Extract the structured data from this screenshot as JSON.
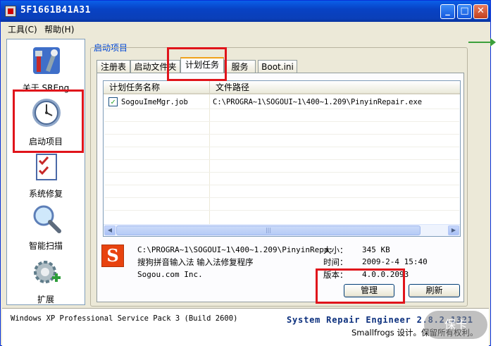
{
  "window": {
    "title": "5F1661B41A31",
    "controls": {
      "minimize": "_",
      "maximize": "□",
      "close": "✕"
    }
  },
  "menu": [
    "工具(C)",
    "帮助(H)"
  ],
  "sidebar": {
    "items": [
      {
        "label": "关于 SREng",
        "icon": "tools-icon"
      },
      {
        "label": "启动项目",
        "icon": "clock-icon"
      },
      {
        "label": "系统修复",
        "icon": "checklist-icon"
      },
      {
        "label": "智能扫描",
        "icon": "magnifier-icon"
      },
      {
        "label": "扩展",
        "icon": "gear-plus-icon"
      }
    ]
  },
  "group_title": "启动项目",
  "tabs": [
    {
      "label": "注册表",
      "active": false
    },
    {
      "label": "启动文件夹",
      "active": false
    },
    {
      "label": "计划任务",
      "active": true
    },
    {
      "label": "服务",
      "active": false
    },
    {
      "label": "Boot.ini",
      "active": false
    }
  ],
  "table": {
    "columns": [
      "计划任务名称",
      "文件路径"
    ],
    "rows": [
      {
        "checked": true,
        "name": "SogouImeMgr.job",
        "path": "C:\\PROGRA~1\\SOGOUI~1\\400~1.209\\PinyinRepair.exe"
      }
    ],
    "scroll_grip": "|||"
  },
  "details": {
    "icon": "S",
    "path": "C:\\PROGRA~1\\SOGOUI~1\\400~1.209\\PinyinRepa:",
    "description": "搜狗拼音输入法 输入法修复程序",
    "company": "Sogou.com Inc.",
    "size_label": "大小：",
    "size_value": "345 KB",
    "time_label": "时间：",
    "time_value": "2009-2-4 15:40",
    "version_label": "版本：",
    "version_value": "4.0.0.2093"
  },
  "buttons": {
    "manage": "管理",
    "refresh": "刷新"
  },
  "status": {
    "os": "Windows XP Professional Service Pack 3 (Build 2600)",
    "product": "System Repair Engineer 2.8.2.1321",
    "copyright": "Smallfrogs 设计。保留所有权利。"
  },
  "watermark": "保卡"
}
